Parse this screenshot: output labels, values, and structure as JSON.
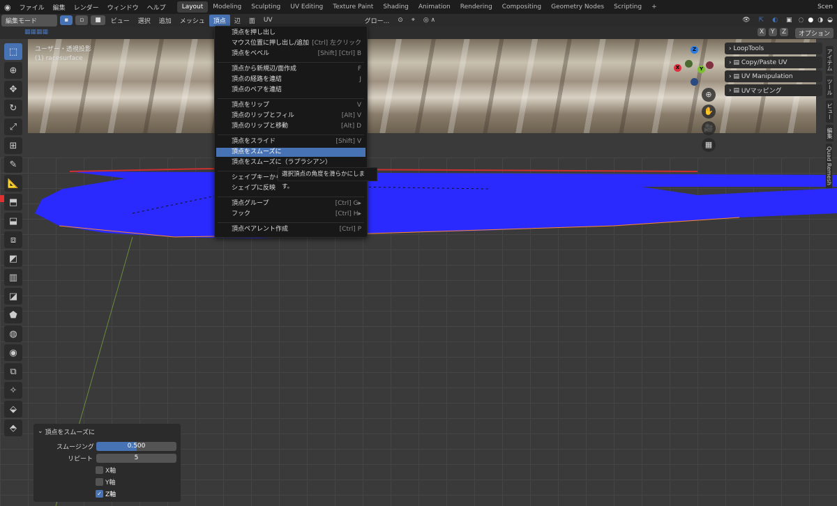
{
  "topbar": {
    "menus": [
      "ファイル",
      "編集",
      "レンダー",
      "ウィンドウ",
      "ヘルプ"
    ],
    "workspaces": [
      "Layout",
      "Modeling",
      "Sculpting",
      "UV Editing",
      "Texture Paint",
      "Shading",
      "Animation",
      "Rendering",
      "Compositing",
      "Geometry Nodes",
      "Scripting"
    ],
    "add": "+",
    "scene": "Scen"
  },
  "header": {
    "mode": "編集モード",
    "menus": [
      "ビュー",
      "選択",
      "追加",
      "メッシュ",
      "頂点",
      "辺",
      "面",
      "UV"
    ],
    "transform": "グロー...",
    "options": "オプション"
  },
  "subheader": {
    "axes": [
      "X",
      "Y",
      "Z"
    ]
  },
  "viewport": {
    "line1": "ユーザー・透視投影",
    "line2": "(1) racesurface"
  },
  "menu": {
    "items": [
      {
        "label": "頂点を押し出し",
        "shortcut": ""
      },
      {
        "label": "マウス位置に押し出し/追加",
        "shortcut": "[Ctrl] 左クリック"
      },
      {
        "label": "頂点をベベル",
        "shortcut": "[Shift] [Ctrl] B"
      },
      {
        "label": "頂点から新規辺/面作成",
        "shortcut": "F"
      },
      {
        "label": "頂点の経路を連結",
        "shortcut": "J"
      },
      {
        "label": "頂点のペアを連結",
        "shortcut": ""
      },
      {
        "label": "頂点をリップ",
        "shortcut": "V"
      },
      {
        "label": "頂点のリップとフィル",
        "shortcut": "[Alt] V"
      },
      {
        "label": "頂点のリップと移動",
        "shortcut": "[Alt] D"
      },
      {
        "label": "頂点をスライド",
        "shortcut": "[Shift] V"
      },
      {
        "label": "頂点をスムーズに",
        "shortcut": ""
      },
      {
        "label": "頂点をスムーズに（ラプラシアン）",
        "shortcut": ""
      },
      {
        "label": "シェイプキーから",
        "shortcut": ""
      },
      {
        "label": "シェイプに反映",
        "shortcut": ""
      },
      {
        "label": "頂点グループ",
        "shortcut": "[Ctrl] G▸"
      },
      {
        "label": "フック",
        "shortcut": "[Ctrl] H▸"
      },
      {
        "label": "頂点ペアレント作成",
        "shortcut": "[Ctrl] P"
      }
    ]
  },
  "tooltip": "選択頂点の角度を滑らかにします。",
  "npanel": {
    "items": [
      "LoopTools",
      "Copy/Paste UV",
      "UV Manipulation",
      "UVマッピング"
    ]
  },
  "tabs": [
    "アイテム",
    "ツール",
    "ビュー",
    "編集",
    "Quad Remesh"
  ],
  "gizmo": {
    "x": "X",
    "y": "Y",
    "z": "Z"
  },
  "redo": {
    "title": "頂点をスムーズに",
    "smoothing_label": "スムージング",
    "smoothing_value": "0.500",
    "smoothing_fraction": 0.5,
    "repeat_label": "リピート",
    "repeat_value": "5",
    "x_label": "X軸",
    "y_label": "Y軸",
    "z_label": "Z軸",
    "z_checked": true
  },
  "colors": {
    "accent": "#4772b3",
    "mesh": "#2a2aff",
    "edge_selected": "#ff8a2a"
  }
}
